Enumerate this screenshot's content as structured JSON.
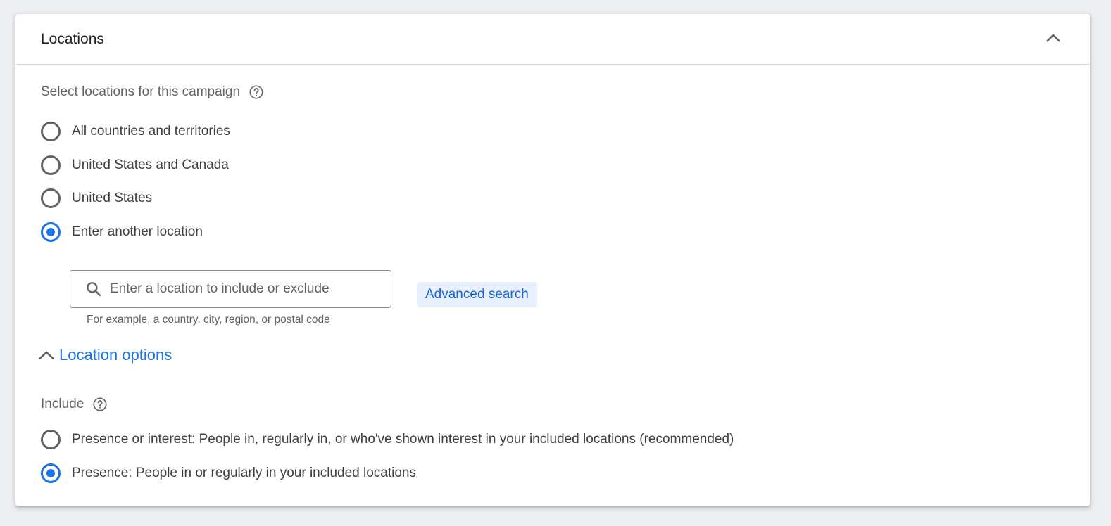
{
  "card": {
    "title": "Locations"
  },
  "locations": {
    "label": "Select locations for this campaign",
    "options": [
      {
        "label": "All countries and territories",
        "checked": false
      },
      {
        "label": "United States and Canada",
        "checked": false
      },
      {
        "label": "United States",
        "checked": false
      },
      {
        "label": "Enter another location",
        "checked": true
      }
    ]
  },
  "search": {
    "placeholder": "Enter a location to include or exclude",
    "value": "",
    "hint": "For example, a country, city, region, or postal code",
    "advanced_label": "Advanced search"
  },
  "location_options": {
    "label": "Location options",
    "include_label": "Include",
    "options": [
      {
        "label": "Presence or interest: People in, regularly in, or who've shown interest in your included locations (recommended)",
        "checked": false
      },
      {
        "label": "Presence: People in or regularly in your included locations",
        "checked": true
      }
    ]
  },
  "colors": {
    "accent": "#1a73e8",
    "advanced_bg": "#e8f0fe",
    "radio_unchecked": "#5f6368"
  },
  "icons": {
    "collapse": "chevron-up-icon",
    "help": "help-circle-icon",
    "search": "search-icon",
    "options_toggle": "chevron-up-icon"
  }
}
